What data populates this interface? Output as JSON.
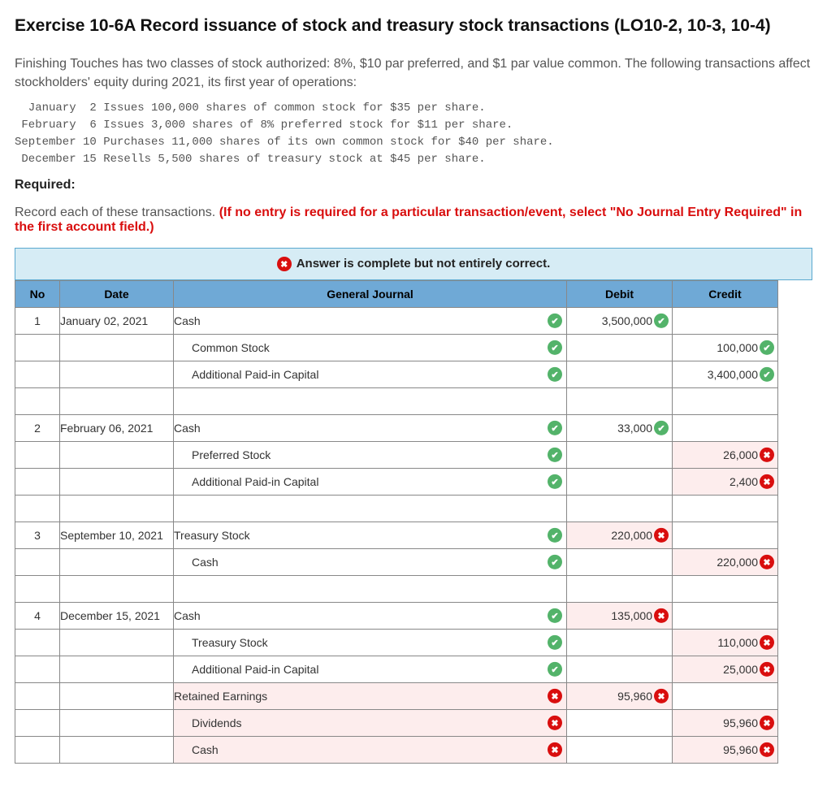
{
  "title": "Exercise 10-6A Record issuance of stock and treasury stock transactions (LO10-2, 10-3, 10-4)",
  "intro": "Finishing Touches has two classes of stock authorized: 8%, $10 par preferred, and $1 par value common. The following transactions affect stockholders' equity during 2021, its first year of operations:",
  "transactions_block": "  January  2 Issues 100,000 shares of common stock for $35 per share.\n February  6 Issues 3,000 shares of 8% preferred stock for $11 per share.\nSeptember 10 Purchases 11,000 shares of its own common stock for $40 per share.\n December 15 Resells 5,500 shares of treasury stock at $45 per share.",
  "required_label": "Required:",
  "required_text": "Record each of these transactions. ",
  "required_red": "(If no entry is required for a particular transaction/event, select \"No Journal Entry Required\" in the first account field.)",
  "status_text": "Answer is complete but not entirely correct.",
  "columns": {
    "no": "No",
    "date": "Date",
    "gj": "General Journal",
    "debit": "Debit",
    "credit": "Credit"
  },
  "rows": [
    {
      "no": "1",
      "date": "January 02, 2021",
      "gj": "Cash",
      "indent": false,
      "gj_mark": "ok",
      "debit": "3,500,000",
      "debit_mark": "ok",
      "credit": "",
      "credit_mark": ""
    },
    {
      "no": "",
      "date": "",
      "gj": "Common Stock",
      "indent": true,
      "gj_mark": "ok",
      "debit": "",
      "debit_mark": "",
      "credit": "100,000",
      "credit_mark": "ok"
    },
    {
      "no": "",
      "date": "",
      "gj": "Additional Paid-in Capital",
      "indent": true,
      "gj_mark": "ok",
      "debit": "",
      "debit_mark": "",
      "credit": "3,400,000",
      "credit_mark": "ok"
    },
    {
      "no": "",
      "date": "",
      "gj": "",
      "indent": false,
      "gj_mark": "",
      "debit": "",
      "debit_mark": "",
      "credit": "",
      "credit_mark": ""
    },
    {
      "no": "2",
      "date": "February 06, 2021",
      "gj": "Cash",
      "indent": false,
      "gj_mark": "ok",
      "debit": "33,000",
      "debit_mark": "ok",
      "credit": "",
      "credit_mark": ""
    },
    {
      "no": "",
      "date": "",
      "gj": "Preferred Stock",
      "indent": true,
      "gj_mark": "ok",
      "debit": "",
      "debit_mark": "",
      "credit": "26,000",
      "credit_mark": "bad",
      "credit_pink": true
    },
    {
      "no": "",
      "date": "",
      "gj": "Additional Paid-in Capital",
      "indent": true,
      "gj_mark": "ok",
      "debit": "",
      "debit_mark": "",
      "credit": "2,400",
      "credit_mark": "bad",
      "credit_pink": true
    },
    {
      "no": "",
      "date": "",
      "gj": "",
      "indent": false,
      "gj_mark": "",
      "debit": "",
      "debit_mark": "",
      "credit": "",
      "credit_mark": ""
    },
    {
      "no": "3",
      "date": "September 10, 2021",
      "gj": "Treasury Stock",
      "indent": false,
      "gj_mark": "ok",
      "debit": "220,000",
      "debit_mark": "bad",
      "debit_pink": true,
      "credit": "",
      "credit_mark": ""
    },
    {
      "no": "",
      "date": "",
      "gj": "Cash",
      "indent": true,
      "gj_mark": "ok",
      "debit": "",
      "debit_mark": "",
      "credit": "220,000",
      "credit_mark": "bad",
      "credit_pink": true
    },
    {
      "no": "",
      "date": "",
      "gj": "",
      "indent": false,
      "gj_mark": "",
      "debit": "",
      "debit_mark": "",
      "credit": "",
      "credit_mark": ""
    },
    {
      "no": "4",
      "date": "December 15, 2021",
      "gj": "Cash",
      "indent": false,
      "gj_mark": "ok",
      "debit": "135,000",
      "debit_mark": "bad",
      "debit_pink": true,
      "credit": "",
      "credit_mark": ""
    },
    {
      "no": "",
      "date": "",
      "gj": "Treasury Stock",
      "indent": true,
      "gj_mark": "ok",
      "debit": "",
      "debit_mark": "",
      "credit": "110,000",
      "credit_mark": "bad",
      "credit_pink": true
    },
    {
      "no": "",
      "date": "",
      "gj": "Additional Paid-in Capital",
      "indent": true,
      "gj_mark": "ok",
      "debit": "",
      "debit_mark": "",
      "credit": "25,000",
      "credit_mark": "bad",
      "credit_pink": true
    },
    {
      "no": "",
      "date": "",
      "gj": "Retained Earnings",
      "indent": false,
      "gj_mark": "bad",
      "gj_pink": true,
      "debit": "95,960",
      "debit_mark": "bad",
      "debit_pink": true,
      "credit": "",
      "credit_mark": ""
    },
    {
      "no": "",
      "date": "",
      "gj": "Dividends",
      "indent": true,
      "gj_mark": "bad",
      "gj_pink": true,
      "debit": "",
      "debit_mark": "",
      "credit": "95,960",
      "credit_mark": "bad",
      "credit_pink": true
    },
    {
      "no": "",
      "date": "",
      "gj": "Cash",
      "indent": true,
      "gj_mark": "bad",
      "gj_pink": true,
      "debit": "",
      "debit_mark": "",
      "credit": "95,960",
      "credit_mark": "bad",
      "credit_pink": true
    }
  ]
}
